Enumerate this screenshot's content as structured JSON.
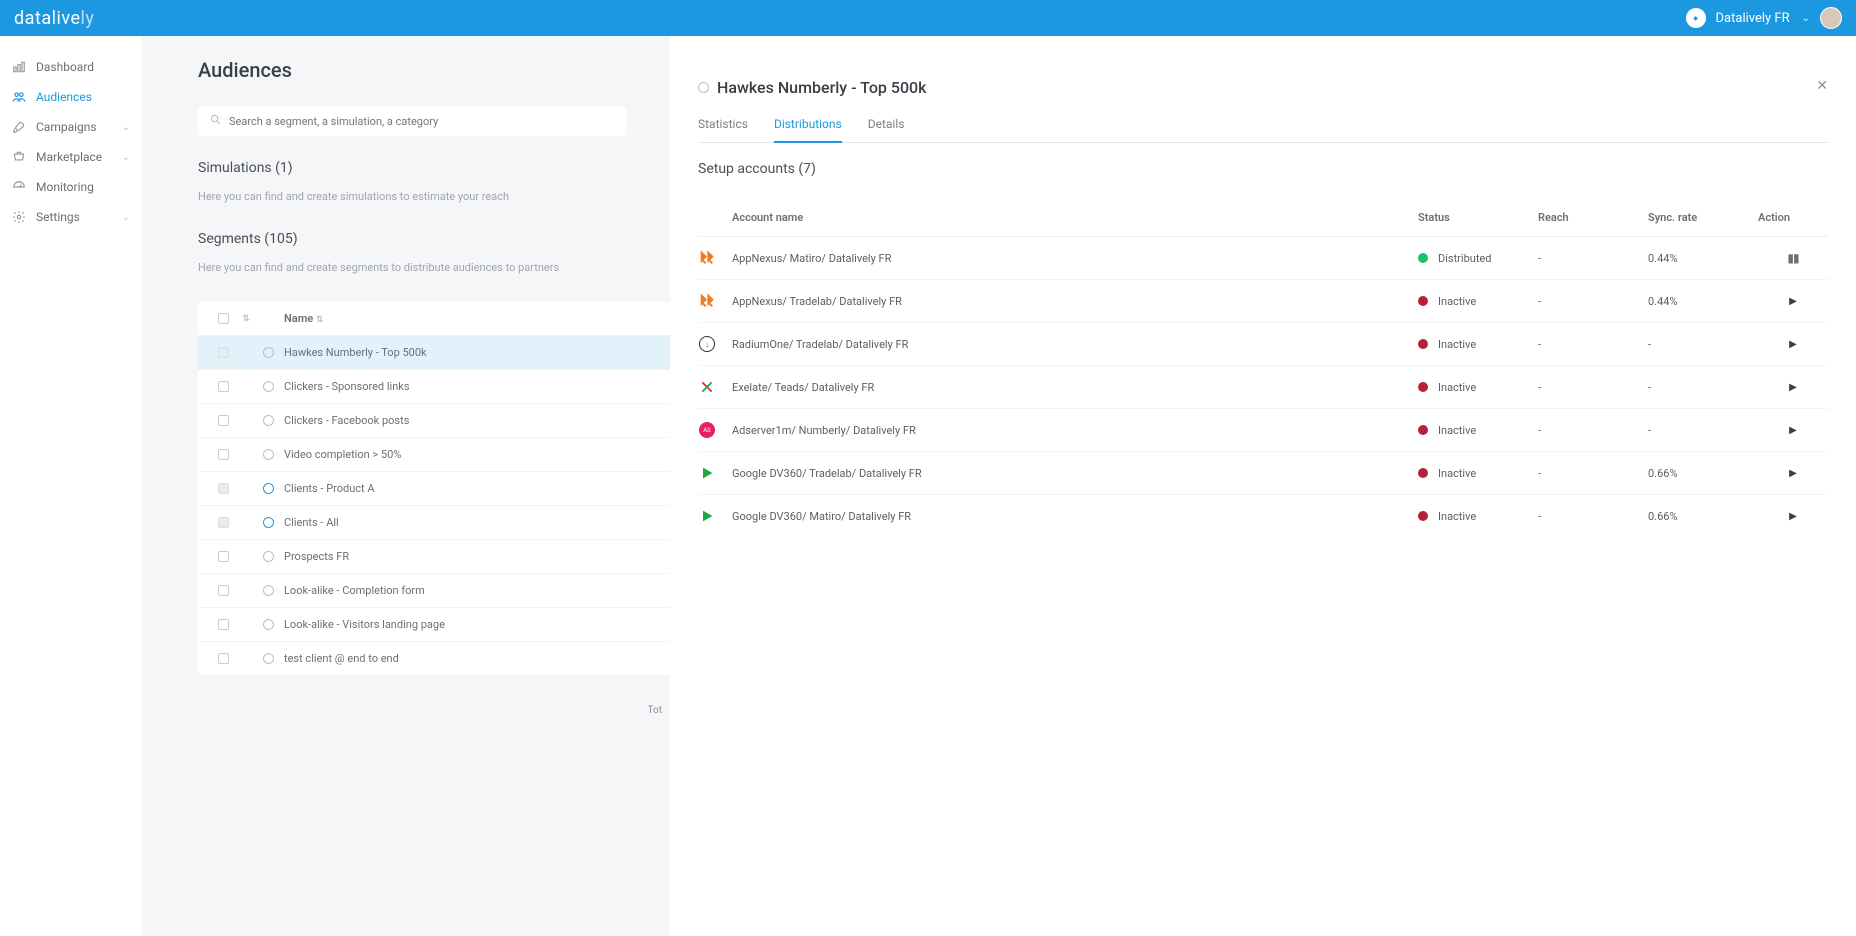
{
  "brand": {
    "prefix": "data",
    "mid": "live",
    "suffix": "ly"
  },
  "org_name": "Datalively FR",
  "sidebar": {
    "items": [
      {
        "label": "Dashboard",
        "icon": "chart-bar-icon",
        "expandable": false,
        "active": false
      },
      {
        "label": "Audiences",
        "icon": "users-icon",
        "expandable": false,
        "active": true
      },
      {
        "label": "Campaigns",
        "icon": "rocket-icon",
        "expandable": true,
        "active": false
      },
      {
        "label": "Marketplace",
        "icon": "cart-icon",
        "expandable": true,
        "active": false
      },
      {
        "label": "Monitoring",
        "icon": "gauge-icon",
        "expandable": false,
        "active": false
      },
      {
        "label": "Settings",
        "icon": "gear-icon",
        "expandable": true,
        "active": false
      }
    ]
  },
  "page_title": "Audiences",
  "search_placeholder": "Search a segment, a simulation, a category",
  "simulations": {
    "title": "Simulations (1)",
    "desc": "Here you can find and create simulations to estimate your reach"
  },
  "segments": {
    "title": "Segments (105)",
    "desc": "Here you can find and create segments to distribute audiences to partners",
    "name_header": "Name",
    "rows": [
      {
        "name": "Hawkes Numberly - Top 500k",
        "selected": true,
        "muted": true,
        "blue_icon": false
      },
      {
        "name": "Clickers - Sponsored links",
        "selected": false,
        "muted": false,
        "blue_icon": false
      },
      {
        "name": "Clickers - Facebook posts",
        "selected": false,
        "muted": false,
        "blue_icon": false
      },
      {
        "name": "Video completion > 50%",
        "selected": false,
        "muted": false,
        "blue_icon": false
      },
      {
        "name": "Clients - Product A",
        "selected": false,
        "muted": true,
        "blue_icon": true
      },
      {
        "name": "Clients - All",
        "selected": false,
        "muted": true,
        "blue_icon": true
      },
      {
        "name": "Prospects FR",
        "selected": false,
        "muted": false,
        "blue_icon": false
      },
      {
        "name": "Look-alike - Completion form",
        "selected": false,
        "muted": false,
        "blue_icon": false
      },
      {
        "name": "Look-alike - Visitors landing page",
        "selected": false,
        "muted": false,
        "blue_icon": false
      },
      {
        "name": "test client @ end to end",
        "selected": false,
        "muted": false,
        "blue_icon": false
      }
    ],
    "totals_prefix": "Tot"
  },
  "detail": {
    "title": "Hawkes Numberly - Top 500k",
    "tabs": [
      {
        "label": "Statistics",
        "active": false
      },
      {
        "label": "Distributions",
        "active": true
      },
      {
        "label": "Details",
        "active": false
      }
    ],
    "setup_title": "Setup accounts (7)",
    "columns": {
      "name": "Account name",
      "status": "Status",
      "reach": "Reach",
      "sync": "Sync. rate",
      "action": "Action"
    },
    "accounts": [
      {
        "name": "AppNexus/ Matiro/ Datalively FR",
        "icon": "appnexus",
        "status": "Distributed",
        "status_color": "green",
        "reach": "-",
        "sync": "0.44%",
        "action": "pause"
      },
      {
        "name": "AppNexus/ Tradelab/ Datalively FR",
        "icon": "appnexus",
        "status": "Inactive",
        "status_color": "red",
        "reach": "-",
        "sync": "0.44%",
        "action": "play"
      },
      {
        "name": "RadiumOne/ Tradelab/ Datalively FR",
        "icon": "radiumone",
        "status": "Inactive",
        "status_color": "red",
        "reach": "-",
        "sync": "-",
        "action": "play"
      },
      {
        "name": "Exelate/ Teads/ Datalively FR",
        "icon": "exelate",
        "status": "Inactive",
        "status_color": "red",
        "reach": "-",
        "sync": "-",
        "action": "play"
      },
      {
        "name": "Adserver1m/ Numberly/ Datalively FR",
        "icon": "adserver",
        "status": "Inactive",
        "status_color": "red",
        "reach": "-",
        "sync": "-",
        "action": "play"
      },
      {
        "name": "Google DV360/ Tradelab/ Datalively FR",
        "icon": "google",
        "status": "Inactive",
        "status_color": "red",
        "reach": "-",
        "sync": "0.66%",
        "action": "play"
      },
      {
        "name": "Google DV360/ Matiro/ Datalively FR",
        "icon": "google",
        "status": "Inactive",
        "status_color": "red",
        "reach": "-",
        "sync": "0.66%",
        "action": "play"
      }
    ]
  }
}
